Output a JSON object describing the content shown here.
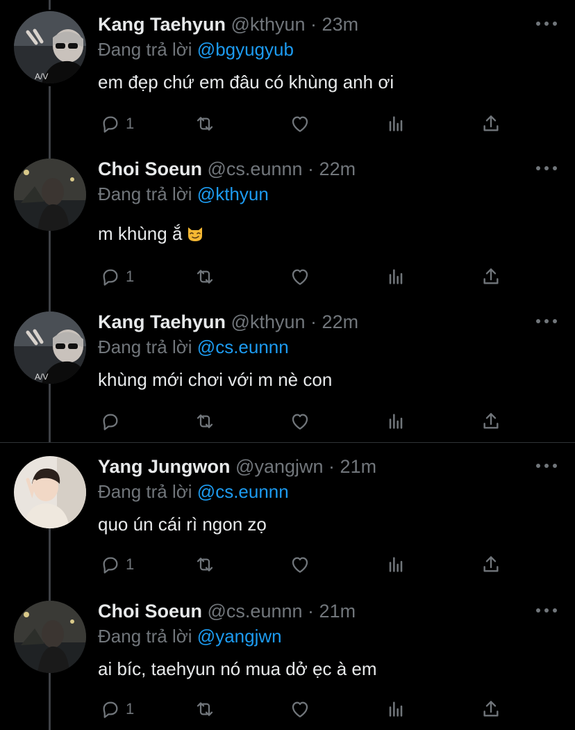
{
  "replying_prefix": "Đang trả lời",
  "tweets": [
    {
      "name": "Kang Taehyun",
      "handle": "@kthyun",
      "dot": "·",
      "time": "23m",
      "reply_to": "@bgyugyub",
      "text": "em đẹp chứ em đâu có khùng anh ơi",
      "reply_count": "1"
    },
    {
      "name": "Choi Soeun",
      "handle": "@cs.eunnn",
      "dot": "·",
      "time": "22m",
      "reply_to": "@kthyun",
      "text": "m khùng ắ",
      "emoji": "smirking-cat-emoji",
      "reply_count": "1"
    },
    {
      "name": "Kang Taehyun",
      "handle": "@kthyun",
      "dot": "·",
      "time": "22m",
      "reply_to": "@cs.eunnn",
      "text": "khùng mới chơi với m nè con",
      "reply_count": ""
    },
    {
      "name": "Yang Jungwon",
      "handle": "@yangjwn",
      "dot": "·",
      "time": "21m",
      "reply_to": "@cs.eunnn",
      "text": "quo ún cái rì ngon zọ",
      "reply_count": "1"
    },
    {
      "name": "Choi Soeun",
      "handle": "@cs.eunnn",
      "dot": "·",
      "time": "21m",
      "reply_to": "@yangjwn",
      "text": "ai bíc, taehyun nó mua dở ẹc à em",
      "reply_count": "1"
    }
  ],
  "icons": [
    "reply-icon",
    "retweet-icon",
    "like-icon",
    "views-icon",
    "share-icon",
    "more-icon"
  ],
  "colors": {
    "background": "#000000",
    "text": "#e7e9ea",
    "muted": "#71767b",
    "link": "#1d9bf0",
    "thread_line": "#3d4045"
  }
}
